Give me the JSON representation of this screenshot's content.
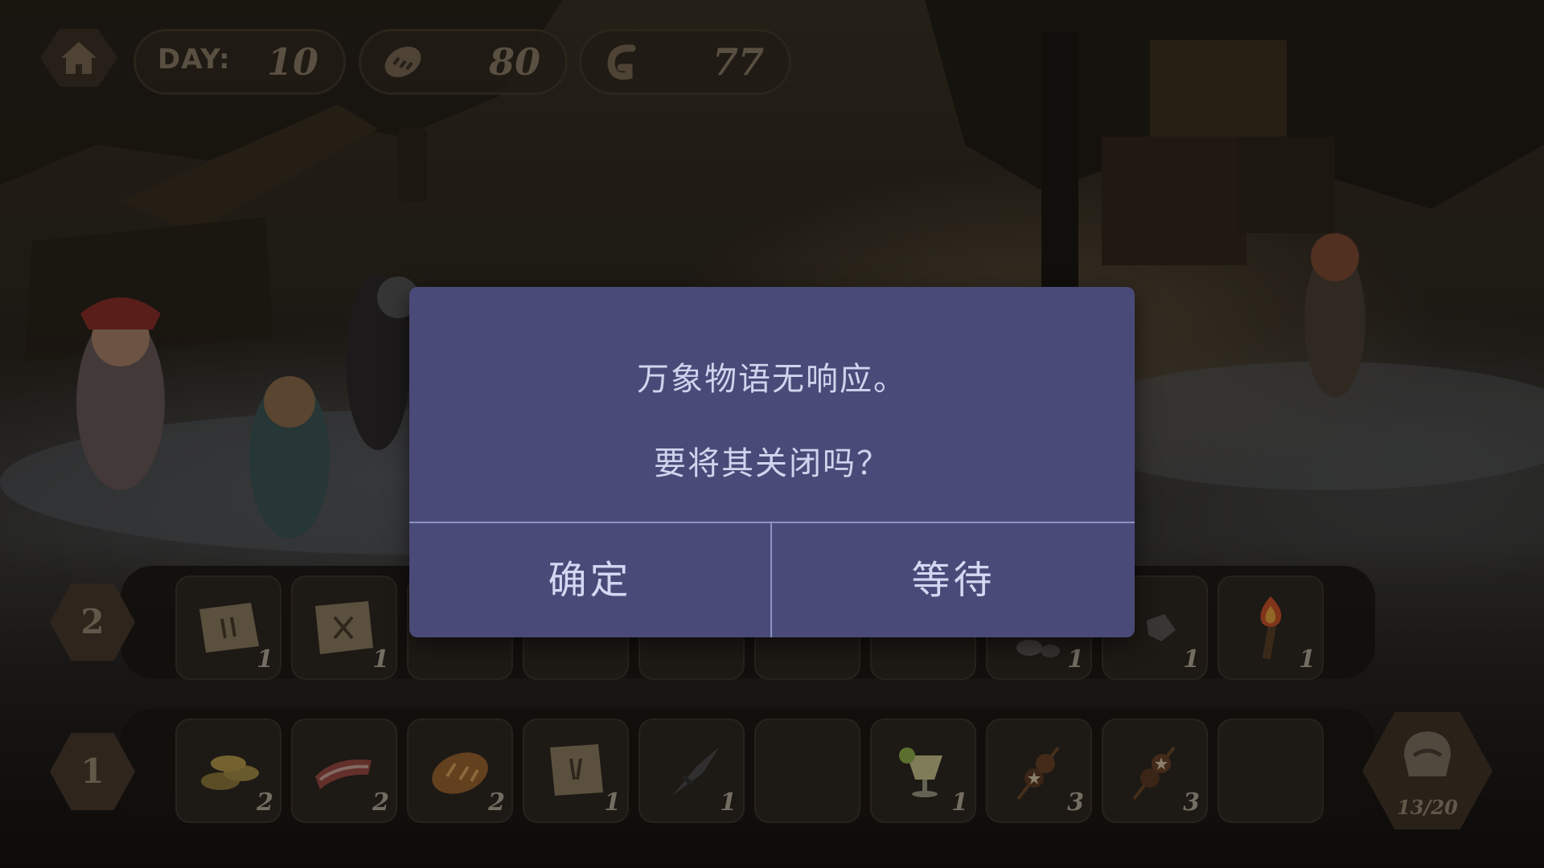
{
  "hud": {
    "home_icon": "house-icon",
    "day_label": "DAY:",
    "day_value": "10",
    "food_icon": "bread-icon",
    "food_value": "80",
    "coin_icon": "coin-icon",
    "coin_value": "77"
  },
  "inventory": {
    "rows": [
      {
        "number": "2",
        "slots": [
          {
            "icon": "map-scroll-icon",
            "count": "1"
          },
          {
            "icon": "map-scroll-icon",
            "count": "1"
          },
          {
            "icon": "",
            "count": ""
          },
          {
            "icon": "",
            "count": ""
          },
          {
            "icon": "",
            "count": ""
          },
          {
            "icon": "",
            "count": ""
          },
          {
            "icon": "",
            "count": ""
          },
          {
            "icon": "ore-rocks-icon",
            "count": "1"
          },
          {
            "icon": "stone-icon",
            "count": "1"
          },
          {
            "icon": "torch-icon",
            "count": "1"
          }
        ]
      },
      {
        "number": "1",
        "slots": [
          {
            "icon": "coins-icon",
            "count": "2"
          },
          {
            "icon": "meat-icon",
            "count": "2"
          },
          {
            "icon": "bread-icon",
            "count": "2"
          },
          {
            "icon": "map-scroll-icon",
            "count": "1"
          },
          {
            "icon": "spear-tip-icon",
            "count": "1"
          },
          {
            "icon": "",
            "count": ""
          },
          {
            "icon": "lemon-drink-icon",
            "count": "1"
          },
          {
            "icon": "kebab-icon",
            "count": "3"
          },
          {
            "icon": "kebab-icon",
            "count": "3"
          },
          {
            "icon": "",
            "count": ""
          }
        ]
      }
    ],
    "bag": {
      "icon": "backpack-icon",
      "capacity": "13/20"
    }
  },
  "dialog": {
    "message": "万象物语无响应。",
    "question": "要将其关闭吗？",
    "ok_label": "确定",
    "wait_label": "等待",
    "colors": {
      "background": "#4a4a78",
      "text": "#cfd4ee",
      "divider": "#8d93c4"
    }
  }
}
